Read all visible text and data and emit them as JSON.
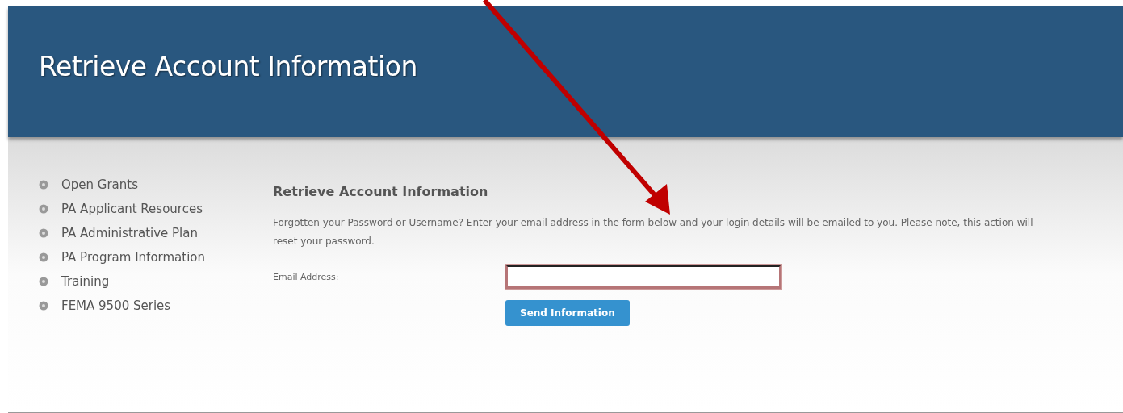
{
  "header": {
    "title": "Retrieve Account Information"
  },
  "sidebar": {
    "items": [
      {
        "label": "Open Grants"
      },
      {
        "label": "PA Applicant Resources"
      },
      {
        "label": "PA Administrative Plan"
      },
      {
        "label": "PA Program Information"
      },
      {
        "label": "Training"
      },
      {
        "label": "FEMA 9500 Series"
      }
    ]
  },
  "form": {
    "heading": "Retrieve Account Information",
    "description": "Forgotten your Password or Username? Enter your email address in the form below and your login details will be emailed to you. Please note, this action will reset your password.",
    "email_label": "Email Address:",
    "submit": "Send Information"
  }
}
